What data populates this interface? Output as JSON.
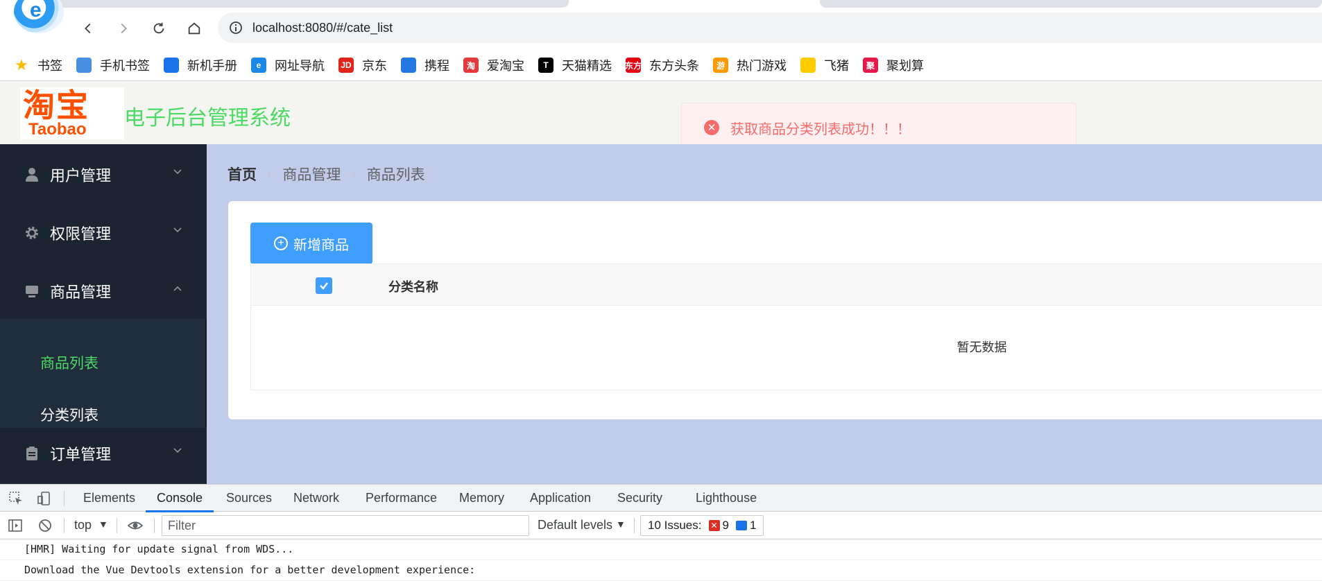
{
  "browser": {
    "url": "localhost:8080/#/cate_list",
    "bookmarks": [
      {
        "label": "书签",
        "icon": "star-icon",
        "color": "#fbbc04",
        "glyph": "★"
      },
      {
        "label": "手机书签",
        "icon": "phone-icon",
        "color": "#4a90e2",
        "glyph": ""
      },
      {
        "label": "新机手册",
        "icon": "doc-icon",
        "color": "#1a73e8",
        "glyph": ""
      },
      {
        "label": "网址导航",
        "icon": "ie-icon",
        "color": "#1b87e6",
        "glyph": "e"
      },
      {
        "label": "京东",
        "icon": "jd-icon",
        "color": "#e1251b",
        "glyph": "JD"
      },
      {
        "label": "携程",
        "icon": "ctrip-icon",
        "color": "#2577e3",
        "glyph": ""
      },
      {
        "label": "爱淘宝",
        "icon": "aitaobao-icon",
        "color": "#e4393c",
        "glyph": "淘"
      },
      {
        "label": "天猫精选",
        "icon": "tmall-icon",
        "color": "#000000",
        "glyph": "T"
      },
      {
        "label": "东方头条",
        "icon": "dftt-icon",
        "color": "#e60012",
        "glyph": "东方"
      },
      {
        "label": "热门游戏",
        "icon": "game-icon",
        "color": "#ff9900",
        "glyph": "游"
      },
      {
        "label": "飞猪",
        "icon": "fliggy-icon",
        "color": "#ffcc00",
        "glyph": ""
      },
      {
        "label": "聚划算",
        "icon": "juhuasuan-icon",
        "color": "#e6194b",
        "glyph": "聚"
      }
    ]
  },
  "header": {
    "logo_cn": "淘宝",
    "logo_en": "Taobao",
    "title": "电子后台管理系统"
  },
  "toast": {
    "message": "获取商品分类列表成功！！！"
  },
  "sidebar": {
    "items": [
      {
        "label": "用户管理"
      },
      {
        "label": "权限管理"
      },
      {
        "label": "商品管理"
      },
      {
        "label": "订单管理"
      }
    ],
    "submenu": [
      {
        "label": "商品列表"
      },
      {
        "label": "分类列表"
      }
    ]
  },
  "breadcrumb": [
    "首页",
    "商品管理",
    "商品列表"
  ],
  "main": {
    "add_button": "新增商品",
    "table": {
      "column_name": "分类名称",
      "empty_text": "暂无数据"
    }
  },
  "devtools": {
    "tabs": [
      "Elements",
      "Console",
      "Sources",
      "Network",
      "Performance",
      "Memory",
      "Application",
      "Security",
      "Lighthouse"
    ],
    "active_tab": "Console",
    "context": "top",
    "filter_placeholder": "Filter",
    "levels": "Default levels",
    "issues_label": "10 Issues:",
    "errors_count": "9",
    "info_count": "1",
    "logs": [
      "[HMR] Waiting for update signal from WDS...",
      "Download the Vue Devtools extension for a better development experience:"
    ]
  },
  "colors": {
    "sidebar_bg": "#1b2431",
    "active_menu": "#4cd964",
    "main_bg": "#c0cce9",
    "primary": "#409eff",
    "error": "#f56c6c"
  }
}
